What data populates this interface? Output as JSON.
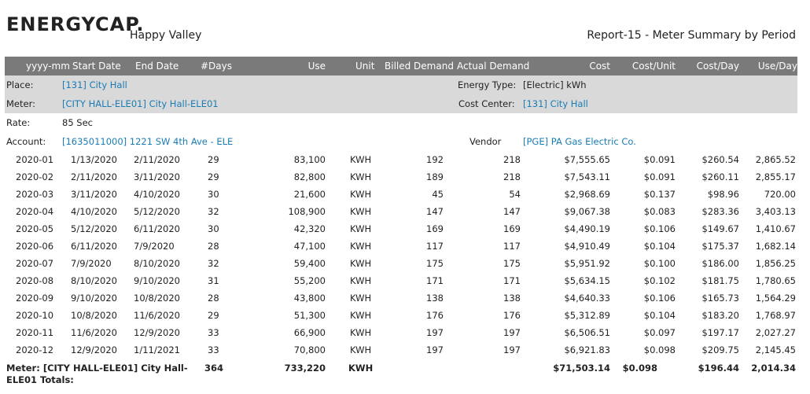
{
  "header": {
    "logo_text": "ENERGYCAP.",
    "organization": "Happy Valley",
    "report_title": "Report-15 - Meter Summary by Period"
  },
  "columns": [
    "yyyy-mm",
    "Start Date",
    "End Date",
    "#Days",
    "Use",
    "Unit",
    "Billed Demand",
    "Actual Demand",
    "Cost",
    "Cost/Unit",
    "Cost/Day",
    "Use/Day"
  ],
  "info": {
    "place_label": "Place:",
    "place_value": "[131]   City Hall",
    "energy_type_label": "Energy Type:",
    "energy_type_value": "[Electric] kWh",
    "meter_label": "Meter:",
    "meter_value": "[CITY HALL-ELE01] City Hall-ELE01",
    "cost_center_label": "Cost Center:",
    "cost_center_value": "[131] City Hall",
    "rate_label": "Rate:",
    "rate_value": "85 Sec",
    "account_label": "Account:",
    "account_value": "[1635011000] 1221 SW 4th Ave - ELE",
    "vendor_label": "Vendor",
    "vendor_value": "[PGE] PA Gas Electric Co."
  },
  "rows": [
    [
      "2020-01",
      "1/13/2020",
      "2/11/2020",
      "29",
      "83,100",
      "KWH",
      "192",
      "218",
      "$7,555.65",
      "$0.091",
      "$260.54",
      "2,865.52"
    ],
    [
      "2020-02",
      "2/11/2020",
      "3/11/2020",
      "29",
      "82,800",
      "KWH",
      "189",
      "218",
      "$7,543.11",
      "$0.091",
      "$260.11",
      "2,855.17"
    ],
    [
      "2020-03",
      "3/11/2020",
      "4/10/2020",
      "30",
      "21,600",
      "KWH",
      "45",
      "54",
      "$2,968.69",
      "$0.137",
      "$98.96",
      "720.00"
    ],
    [
      "2020-04",
      "4/10/2020",
      "5/12/2020",
      "32",
      "108,900",
      "KWH",
      "147",
      "147",
      "$9,067.38",
      "$0.083",
      "$283.36",
      "3,403.13"
    ],
    [
      "2020-05",
      "5/12/2020",
      "6/11/2020",
      "30",
      "42,320",
      "KWH",
      "169",
      "169",
      "$4,490.19",
      "$0.106",
      "$149.67",
      "1,410.67"
    ],
    [
      "2020-06",
      "6/11/2020",
      "7/9/2020",
      "28",
      "47,100",
      "KWH",
      "117",
      "117",
      "$4,910.49",
      "$0.104",
      "$175.37",
      "1,682.14"
    ],
    [
      "2020-07",
      "7/9/2020",
      "8/10/2020",
      "32",
      "59,400",
      "KWH",
      "175",
      "175",
      "$5,951.92",
      "$0.100",
      "$186.00",
      "1,856.25"
    ],
    [
      "2020-08",
      "8/10/2020",
      "9/10/2020",
      "31",
      "55,200",
      "KWH",
      "171",
      "171",
      "$5,634.15",
      "$0.102",
      "$181.75",
      "1,780.65"
    ],
    [
      "2020-09",
      "9/10/2020",
      "10/8/2020",
      "28",
      "43,800",
      "KWH",
      "138",
      "138",
      "$4,640.33",
      "$0.106",
      "$165.73",
      "1,564.29"
    ],
    [
      "2020-10",
      "10/8/2020",
      "11/6/2020",
      "29",
      "51,300",
      "KWH",
      "176",
      "176",
      "$5,312.89",
      "$0.104",
      "$183.20",
      "1,768.97"
    ],
    [
      "2020-11",
      "11/6/2020",
      "12/9/2020",
      "33",
      "66,900",
      "KWH",
      "197",
      "197",
      "$6,506.51",
      "$0.097",
      "$197.17",
      "2,027.27"
    ],
    [
      "2020-12",
      "12/9/2020",
      "1/11/2021",
      "33",
      "70,800",
      "KWH",
      "197",
      "197",
      "$6,921.83",
      "$0.098",
      "$209.75",
      "2,145.45"
    ]
  ],
  "totals": {
    "label_line1": "Meter: [CITY HALL-ELE01] City Hall-",
    "label_line2": "ELE01 Totals:",
    "days": "364",
    "use": "733,220",
    "unit": "KWH",
    "cost": "$71,503.14",
    "cost_unit": "$0.098",
    "cost_day": "$196.44",
    "use_day": "2,014.34"
  }
}
